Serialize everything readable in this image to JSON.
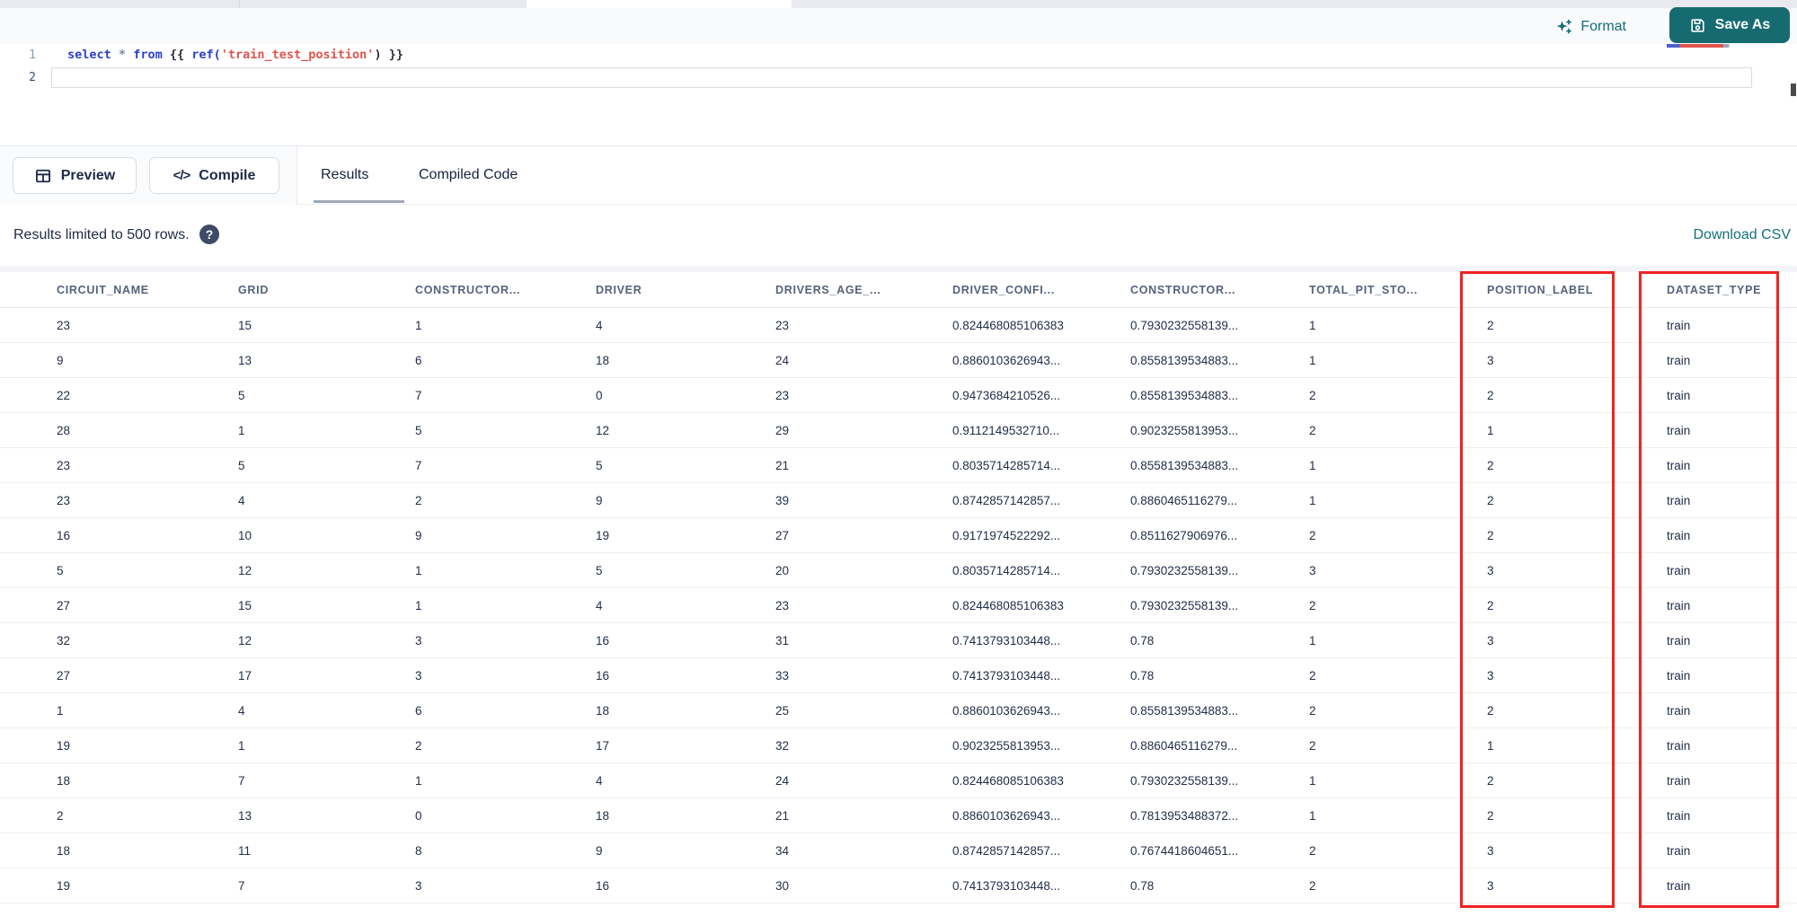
{
  "toolbar": {
    "format_label": "Format",
    "save_as_label": "Save As"
  },
  "editor": {
    "line_numbers": [
      "1",
      "2"
    ],
    "code_tokens": [
      {
        "text": "select",
        "type": "keyword"
      },
      {
        "text": " ",
        "type": "plain"
      },
      {
        "text": "*",
        "type": "operator"
      },
      {
        "text": " ",
        "type": "plain"
      },
      {
        "text": "from",
        "type": "keyword"
      },
      {
        "text": " {{ ",
        "type": "plain"
      },
      {
        "text": "ref(",
        "type": "function"
      },
      {
        "text": "'train_test_position'",
        "type": "string"
      },
      {
        "text": ") }}",
        "type": "plain"
      }
    ]
  },
  "actions": {
    "preview_label": "Preview",
    "compile_label": "Compile",
    "compile_glyph": "</>"
  },
  "tabs": [
    {
      "label": "Results",
      "active": true
    },
    {
      "label": "Compiled Code",
      "active": false
    }
  ],
  "results_bar": {
    "limit_text": "Results limited to 500 rows.",
    "help_glyph": "?",
    "download_label": "Download CSV"
  },
  "table": {
    "columns": [
      "CIRCUIT_NAME",
      "GRID",
      "CONSTRUCTOR...",
      "DRIVER",
      "DRIVERS_AGE_...",
      "DRIVER_CONFI...",
      "CONSTRUCTOR...",
      "TOTAL_PIT_STO...",
      "POSITION_LABEL",
      "DATASET_TYPE"
    ],
    "rows": [
      [
        "23",
        "15",
        "1",
        "4",
        "23",
        "0.824468085106383",
        "0.7930232558139...",
        "1",
        "2",
        "train"
      ],
      [
        "9",
        "13",
        "6",
        "18",
        "24",
        "0.8860103626943...",
        "0.8558139534883...",
        "1",
        "3",
        "train"
      ],
      [
        "22",
        "5",
        "7",
        "0",
        "23",
        "0.9473684210526...",
        "0.8558139534883...",
        "2",
        "2",
        "train"
      ],
      [
        "28",
        "1",
        "5",
        "12",
        "29",
        "0.9112149532710...",
        "0.9023255813953...",
        "2",
        "1",
        "train"
      ],
      [
        "23",
        "5",
        "7",
        "5",
        "21",
        "0.8035714285714...",
        "0.8558139534883...",
        "1",
        "2",
        "train"
      ],
      [
        "23",
        "4",
        "2",
        "9",
        "39",
        "0.8742857142857...",
        "0.8860465116279...",
        "1",
        "2",
        "train"
      ],
      [
        "16",
        "10",
        "9",
        "19",
        "27",
        "0.9171974522292...",
        "0.8511627906976...",
        "2",
        "2",
        "train"
      ],
      [
        "5",
        "12",
        "1",
        "5",
        "20",
        "0.8035714285714...",
        "0.7930232558139...",
        "3",
        "3",
        "train"
      ],
      [
        "27",
        "15",
        "1",
        "4",
        "23",
        "0.824468085106383",
        "0.7930232558139...",
        "2",
        "2",
        "train"
      ],
      [
        "32",
        "12",
        "3",
        "16",
        "31",
        "0.7413793103448...",
        "0.78",
        "1",
        "3",
        "train"
      ],
      [
        "27",
        "17",
        "3",
        "16",
        "33",
        "0.7413793103448...",
        "0.78",
        "2",
        "3",
        "train"
      ],
      [
        "1",
        "4",
        "6",
        "18",
        "25",
        "0.8860103626943...",
        "0.8558139534883...",
        "2",
        "2",
        "train"
      ],
      [
        "19",
        "1",
        "2",
        "17",
        "32",
        "0.9023255813953...",
        "0.8860465116279...",
        "2",
        "1",
        "train"
      ],
      [
        "18",
        "7",
        "1",
        "4",
        "24",
        "0.824468085106383",
        "0.7930232558139...",
        "1",
        "2",
        "train"
      ],
      [
        "2",
        "13",
        "0",
        "18",
        "21",
        "0.8860103626943...",
        "0.7813953488372...",
        "1",
        "2",
        "train"
      ],
      [
        "18",
        "11",
        "8",
        "9",
        "34",
        "0.8742857142857...",
        "0.7674418604651...",
        "2",
        "3",
        "train"
      ],
      [
        "19",
        "7",
        "3",
        "16",
        "30",
        "0.7413793103448...",
        "0.78",
        "2",
        "3",
        "train"
      ]
    ]
  },
  "annotations": {
    "boxes": [
      {
        "column": "POSITION_LABEL"
      },
      {
        "column": "DATASET_TYPE"
      }
    ],
    "color": "#ee2423"
  },
  "colors": {
    "accent_teal": "#166b70",
    "link_teal": "#14707b",
    "text_navy": "#1e2a47",
    "keyword_blue": "#2b3fd0",
    "string_red": "#e0544b",
    "annotation_red": "#ee2423"
  }
}
